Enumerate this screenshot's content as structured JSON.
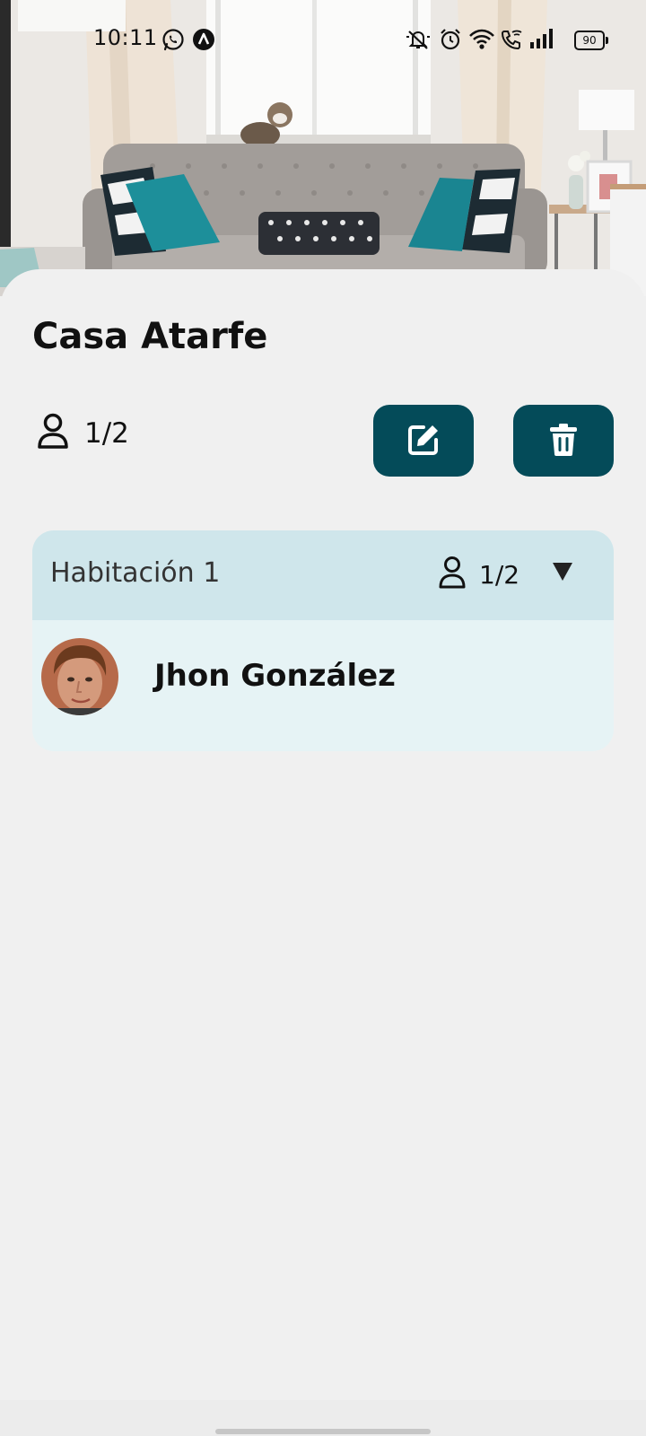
{
  "status_bar": {
    "time": "10:11",
    "left_icons": [
      "whatsapp-icon",
      "app-notification-icon"
    ],
    "right_icons": [
      "notifications-muted-icon",
      "alarm-icon",
      "wifi-icon",
      "wifi-calling-icon",
      "signal-icon",
      "battery-icon"
    ],
    "battery_level": "90"
  },
  "property": {
    "title": "Casa Atarfe",
    "occupancy": "1/2",
    "actions": {
      "edit_icon": "edit-icon",
      "delete_icon": "trash-icon",
      "button_color": "#044b59"
    }
  },
  "rooms": [
    {
      "name": "Habitación 1",
      "occupancy": "1/2",
      "expanded": true,
      "header_color": "#cfe6eb",
      "body_color": "#e6f3f5",
      "residents": [
        {
          "name": "Jhon González"
        }
      ]
    }
  ],
  "colors": {
    "accent": "#044b59",
    "background": "#f0f0f0"
  }
}
